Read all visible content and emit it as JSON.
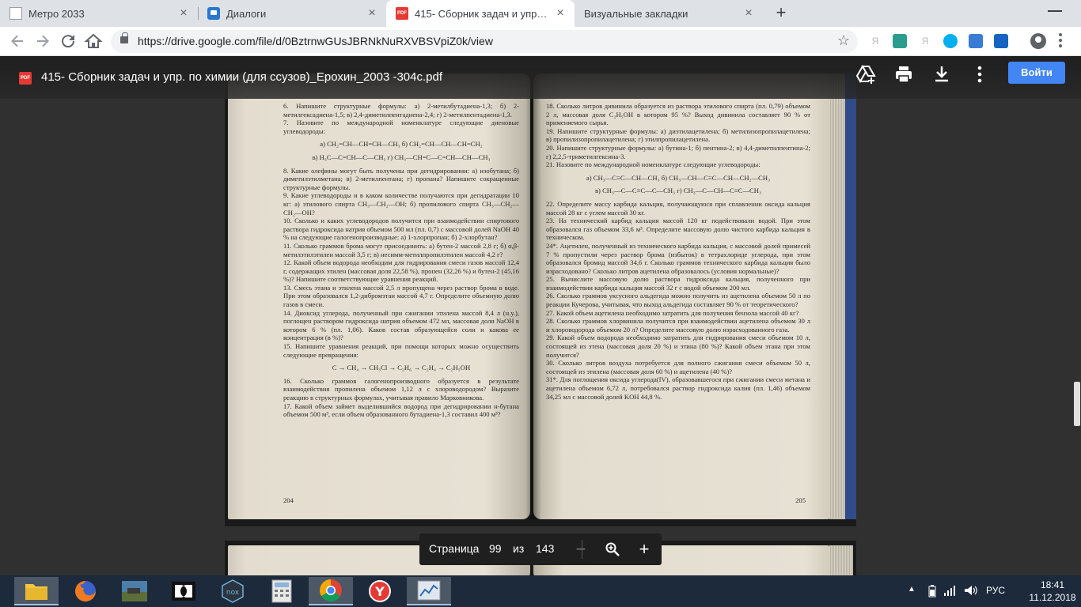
{
  "tabs": [
    {
      "title": "Метро 2033",
      "active": false
    },
    {
      "title": "Диалоги",
      "active": false
    },
    {
      "title": "415- Сборник задач и упр. по х",
      "active": true
    },
    {
      "title": "Визуальные закладки",
      "active": false
    }
  ],
  "toolbar": {
    "url": "https://drive.google.com/file/d/0BztrnwGUsJBRNkNuRXVBSVpiZ0k/view",
    "ext_ya_label": "Я"
  },
  "viewer": {
    "title": "415- Сборник задач и упр. по химии (для ссузов)_Ерохин_2003 -304с.pdf",
    "login_label": "Войти"
  },
  "pager": {
    "label": "Страница",
    "current": "99",
    "of_label": "из",
    "total": "143"
  },
  "book": {
    "left_paragraphs": [
      "6. Напишите структурные формулы: а) 2-метилбутадиена-1,3; б) 2-метилгексадиена-1,5; в) 2,4-диметилпентадиена-2,4; г) 2-метилпентадиена-1,3.",
      "7. Назовите по международной номенклатуре следующие диеновые углеводороды:"
    ],
    "left_formula_1": "а) CH₂=CH—CH=CH—CH₃   б) CH₂=CH—CH—CH=CH₂",
    "left_formula_2": "в) H₃C—C=CH—C—CH₃   г) CH₃—CH=C—C=CH—CH—CH₃",
    "left_paragraphs_2": [
      "8. Какие олефины могут быть получены при дегидрировании: а) изобутана; б) диметилэтилметана; в) 2-метилпентана; г) пропана? Напишите сокращенные структурные формулы.",
      "9. Какие углеводороды и в каком количестве получаются при дегидратации 10 кг: а) этилового спирта CH₃—CH₂—OH; б) пропилового спирта CH₃—CH₂—CH₂—OH?",
      "10. Сколько и каких углеводородов получится при взаимодействии спиртового раствора гидроксида натрия объемом 500 мл (пл. 0,7) с массовой долей NaOH 40 % на следующие галогенопроизводные: а) 1-хлорпропан; б) 2-хлорбутан?",
      "11. Сколько граммов брома могут присоединить: а) бутен-2 массой 2,8 г; б) α,β-метилэтилэтилен массой 3,5 г; в) несимм-метилпропилэтилен массой 4,2 г?",
      "12. Какой объем водорода необходим для гидрирования смеси газов массой 12,4 г, содержащих этилен (массовая доля 22,58 %), пропен (32,26 %) и бутен-2 (45,16 %)? Напишите соответствующие уравнения реакций.",
      "13. Смесь этана и этилена массой 2,5 л пропущена через раствор брома в воде. При этом образовался 1,2-дибромэтан массой 4,7 г. Определите объемную долю газов в смеси.",
      "14. Диоксид углерода, полученный при сжигании этилена массой 8,4 л (н.у.), поглощен раствором гидроксида натрия объемом 472 мл, массовая доля NaOH в котором 6 % (пл. 1,06). Каков состав образующейся соли и какова ее концентрация (в %)?",
      "15. Напишите уравнения реакций, при помощи которых можно осуществить следующие превращения:"
    ],
    "left_formula_3": "C → CH₄ → CH₃Cl → C₂H₆ → C₂H₄ → C₂H₅OH",
    "left_paragraphs_3": [
      "16. Сколько граммов галогенопроизводного образуется в результате взаимодействия пропилена объемом 1,12 л с хлороводородом? Выразите реакцию в структурных формулах, учитывая правило Марковникова.",
      "17. Какой объем займет выделившийся водород при дегидрировании н-бутана объемом 500 м³, если объем образованного бутадиена-1,3 составил 400 м³?"
    ],
    "left_page_number": "204",
    "right_paragraphs": [
      "18. Сколько литров дивинила образуется из раствора этилового спирта (пл. 0,79) объемом 2 л, массовая доля C₂H₅OH в котором 95 %? Выход дивинила составляет 90 % от применяемого сырья.",
      "19. Напишите структурные формулы: а) диэтилацетилена; б) метилизопропилацетилена; в) пропилизопропилацетилена; г) этилпропилацетилена.",
      "20. Напишите структурные формулы: а) бутина-1; б) пентина-2; в) 4,4-диметилпентина-2; г) 2,2,5-триметилгексина-3.",
      "21. Назовите по международной номенклатуре следующие углеводороды:"
    ],
    "right_formula_1": "а) CH₃—C≡C—CH—CH₃   б) CH₃—CH—C≡C—CH—CH₂—CH₃",
    "right_formula_2": "в) CH₃—C—C≡C—C—CH₃   г) CH₃—C—CH—C≡C—CH₃",
    "right_paragraphs_2": [
      "22. Определите массу карбида кальция, получающуюся при сплавлении оксида кальция массой 28 кг с углем массой 30 кг.",
      "23. На технический карбид кальция массой 120 кг подействовали водой. При этом образовался газ объемом 33,6 м³. Определите массовую долю чистого карбида кальция в техническом.",
      "24*. Ацетилен, полученный из технического карбида кальция, с массовой долей примесей 7 % пропустили через раствор брома (избыток) в тетрахлориде углерода, при этом образовался бромид массой 34,6 г. Сколько граммов технического карбида кальция было израсходовано? Сколько литров ацетилена образовалось (условия нормальные)?",
      "25. Вычислите массовую долю раствора гидроксида кальция, полученного при взаимодействии карбида кальция массой 32 г с водой объемом 200 мл.",
      "26. Сколько граммов уксусного альдегида можно получить из ацетилена объемом 50 л по реакции Кучерова, учитывая, что выход альдегида составляет 90 % от теоретического?",
      "27. Какой объем ацетилена необходимо затратить для получения бензола массой 40 кг?",
      "28. Сколько граммов хлорвинила получится при взаимодействии ацетилена объемом 30 л и хлороводорода объемом 20 л? Определите массовую долю израсходованного газа.",
      "29. Какой объем водорода необходимо затратить для гидрирования смеси объемом 10 л, состоящей из этена (массовая доля 20 %) и этина (80 %)? Какой объем этана при этом получится?",
      "30. Сколько литров воздуха потребуется для полного сжигания смеси объемом 50 л, состоящей из этилена (массовая доля 60 %) и ацетилена (40 %)?",
      "31*. Для поглощения оксида углерода(IV), образовавшегося при сжигании смеси метана и ацетилена объемом 6,72 л, потребовался раствор гидроксида калия (пл. 1,46) объемом 34,25 мл с массовой долей KOH 44,8 %."
    ],
    "right_page_number": "205"
  },
  "taskbar": {
    "lang": "РУС",
    "time": "18:41",
    "date": "11.12.2018"
  }
}
